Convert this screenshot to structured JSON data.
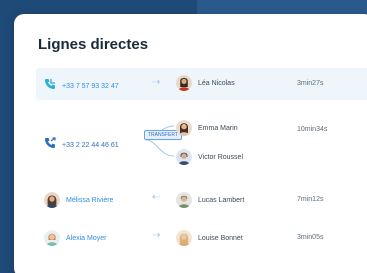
{
  "card": {
    "title": "Lignes directes"
  },
  "rows": [
    {
      "number": "+33 7 57 93 32 47",
      "agent": "Léa Nicolas",
      "duration": "3min27s"
    },
    {
      "number": "+33 2 22 44 46 61",
      "agents": [
        "Emma Marin",
        "Victor Roussel"
      ],
      "transfer_label": "TRANSFERT",
      "duration": "10min34s"
    },
    {
      "caller": "Mélissa Rivière",
      "agent": "Lucas Lambert",
      "duration": "7min12s"
    },
    {
      "caller": "Alexia Moyer",
      "agent": "Louise Bonnet",
      "duration": "3min05s"
    }
  ],
  "colors": {
    "accent": "#2f8fe0",
    "background": "#1f4a78",
    "highlight": "#eef5fb"
  }
}
